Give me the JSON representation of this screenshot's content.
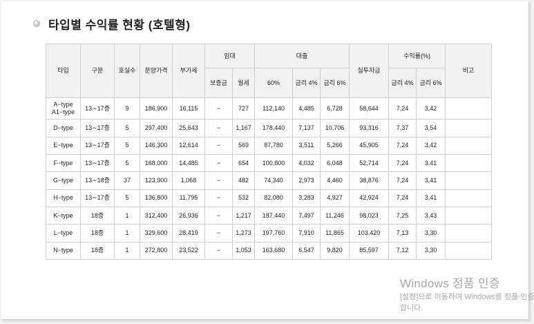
{
  "title": "타입별 수익률 현황 (호텔형)",
  "table": {
    "headers": {
      "type": "타입",
      "division": "구분",
      "rooms": "호실수",
      "price": "분양가격",
      "vat": "부가세",
      "lease": "임대",
      "deposit": "보증금",
      "monthly_rent": "월세",
      "loan": "대출",
      "loan_60": "60%",
      "interest_4": "금리 4%",
      "interest_6": "금리 6%",
      "actual_investment": "실투자금",
      "yield": "수익률(%)",
      "yield_4": "금리 4%",
      "yield_6": "금리 6%",
      "remarks": "비고"
    },
    "rows": [
      {
        "type": "A−type\nA1−type",
        "division": "13∼17층",
        "rooms": "9",
        "price": "186,900",
        "vat": "16,115",
        "deposit": "−",
        "rent": "727",
        "loan60": "112,140",
        "int4": "4,485",
        "int6": "6,728",
        "invest": "58,644",
        "y4": "7,24",
        "y6": "3,42",
        "note": ""
      },
      {
        "type": "D−type",
        "division": "13∼17층",
        "rooms": "5",
        "price": "297,400",
        "vat": "25,643",
        "deposit": "−",
        "rent": "1,167",
        "loan60": "178,440",
        "int4": "7,137",
        "int6": "10,706",
        "invest": "93,316",
        "y4": "7,37",
        "y6": "3,54",
        "note": ""
      },
      {
        "type": "E−type",
        "division": "13∼17층",
        "rooms": "5",
        "price": "146,300",
        "vat": "12,614",
        "deposit": "−",
        "rent": "569",
        "loan60": "87,780",
        "int4": "3,511",
        "int6": "5,266",
        "invest": "45,905",
        "y4": "7,24",
        "y6": "3,42",
        "note": ""
      },
      {
        "type": "F−type",
        "division": "13∼17층",
        "rooms": "5",
        "price": "168,000",
        "vat": "14,485",
        "deposit": "−",
        "rent": "654",
        "loan60": "100,800",
        "int4": "4,032",
        "int6": "6,048",
        "invest": "52,714",
        "y4": "7,24",
        "y6": "3,41",
        "note": ""
      },
      {
        "type": "G−type",
        "division": "13∼18층",
        "rooms": "37",
        "price": "123,900",
        "vat": "1,068",
        "deposit": "−",
        "rent": "482",
        "loan60": "74,340",
        "int4": "2,973",
        "int6": "4,460",
        "invest": "38,876",
        "y4": "7,24",
        "y6": "3,41",
        "note": ""
      },
      {
        "type": "H−type",
        "division": "13∼17층",
        "rooms": "5",
        "price": "136,800",
        "vat": "11,795",
        "deposit": "−",
        "rent": "532",
        "loan60": "82,080",
        "int4": "3,283",
        "int6": "4,927",
        "invest": "42,924",
        "y4": "7,24",
        "y6": "3,41",
        "note": ""
      },
      {
        "type": "K−type",
        "division": "18층",
        "rooms": "1",
        "price": "312,400",
        "vat": "26,936",
        "deposit": "−",
        "rent": "1,217",
        "loan60": "187,440",
        "int4": "7,497",
        "int6": "11,246",
        "invest": "98,023",
        "y4": "7,25",
        "y6": "3,43",
        "note": ""
      },
      {
        "type": "L−type",
        "division": "18층",
        "rooms": "1",
        "price": "329,600",
        "vat": "28,419",
        "deposit": "−",
        "rent": "1,273",
        "loan60": "197,760",
        "int4": "7,910",
        "int6": "11,865",
        "invest": "103,420",
        "y4": "7,13",
        "y6": "3,30",
        "note": ""
      },
      {
        "type": "N−type",
        "division": "18층",
        "rooms": "1",
        "price": "272,800",
        "vat": "23,522",
        "deposit": "−",
        "rent": "1,053",
        "loan60": "163,680",
        "int4": "6,547",
        "int6": "9,820",
        "invest": "85,597",
        "y4": "7,12",
        "y6": "3,30",
        "note": ""
      }
    ]
  },
  "watermark": {
    "title": "Windows 정품 인증",
    "subtitle": "[설정]으로 이동하여 Windows를 정품 인증합니다."
  }
}
